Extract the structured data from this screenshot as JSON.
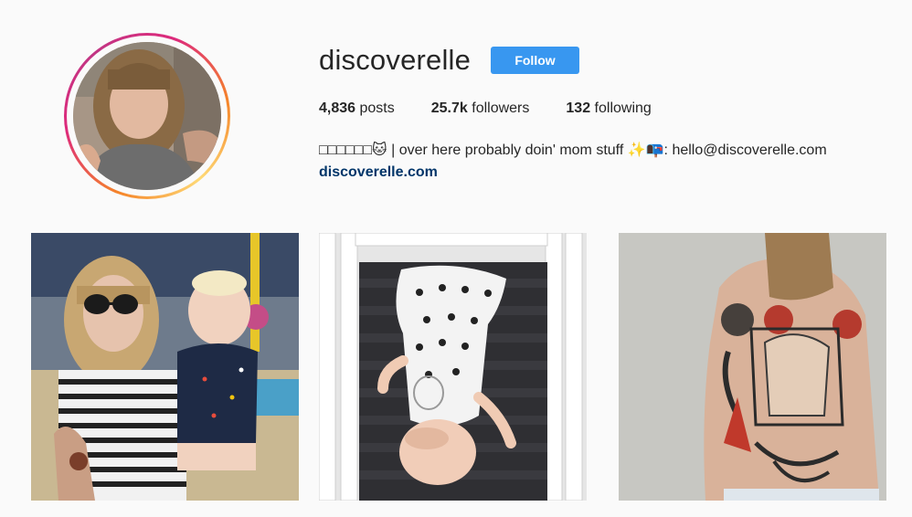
{
  "profile": {
    "username": "discoverelle",
    "follow_label": "Follow",
    "avatar_icon": "profile-photo",
    "ring_colors": [
      "#f58529",
      "#dd2a7b",
      "#c13584",
      "#feda77"
    ],
    "stats": {
      "posts_count": "4,836",
      "posts_label": "posts",
      "followers_count": "25.7k",
      "followers_label": "followers",
      "following_count": "132",
      "following_label": "following"
    },
    "bio": "□□□□□□🐱 | over here probably doin' mom stuff ✨📭: hello@discoverelle.com",
    "website": "discoverelle.com"
  },
  "colors": {
    "follow_button": "#3897f0",
    "link": "#003569",
    "background": "#fafafa"
  },
  "posts": [
    {
      "name": "mother-holding-baby-photo"
    },
    {
      "name": "baby-sleeping-in-crib-photo"
    },
    {
      "name": "back-tattoo-photo"
    }
  ]
}
